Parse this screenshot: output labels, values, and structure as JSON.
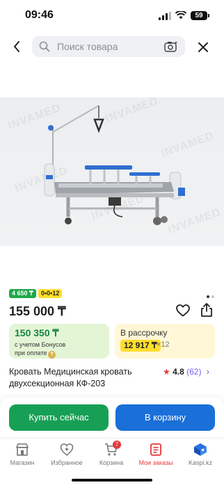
{
  "status_bar": {
    "time": "09:46",
    "battery": "59"
  },
  "search": {
    "placeholder": "Поиск товара"
  },
  "product": {
    "watermark": "INVAMED",
    "badges": {
      "bonus": "4 650 ₸",
      "installment": "0•0•12"
    },
    "price": "155 000 ₸",
    "bonus_card": {
      "price": "150 350 ₸",
      "line1": "с учетом Бонусов",
      "line2": "при оплате"
    },
    "installment_card": {
      "label": "В рассрочку",
      "amount": "12 917 ₸",
      "months": "×12"
    },
    "title": "Кровать Медицинская кровать двухсекционная КФ-203",
    "rating": {
      "score": "4.8",
      "count": "(62)"
    },
    "image_dots": {
      "count": 2,
      "active": 0
    }
  },
  "actions": {
    "buy_now": "Купить сейчас",
    "add_to_cart": "В корзину"
  },
  "tabbar": {
    "items": [
      {
        "label": "Магазин",
        "icon": "store-icon"
      },
      {
        "label": "Избранное",
        "icon": "heart-plus-icon"
      },
      {
        "label": "Корзина",
        "icon": "cart-icon",
        "badge": "7"
      },
      {
        "label": "Мои заказы",
        "icon": "orders-icon",
        "active": true
      },
      {
        "label": "Kaspi.kz",
        "icon": "kaspi-gift-icon"
      }
    ]
  },
  "colors": {
    "accent_red": "#e5383b",
    "green": "#17a055",
    "blue": "#1a6fd9",
    "yellow": "#ffdd2d"
  }
}
